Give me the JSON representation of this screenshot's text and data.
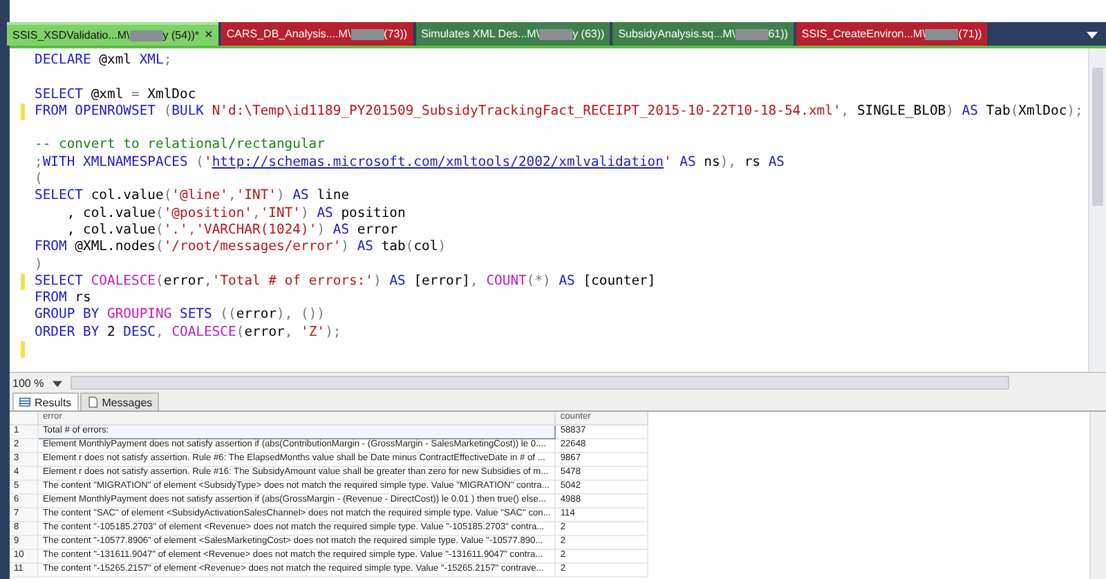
{
  "tabs": [
    {
      "label_start": "SSIS_XSDValidatio...M\\",
      "label_end": "y (54))*",
      "redacted": true,
      "color": "#7fd16a",
      "selected": true,
      "close": "×"
    },
    {
      "label_start": "CARS_DB_Analysis....M\\",
      "label_end": "(73))",
      "redacted": true,
      "color": "#b8202e",
      "selected": false
    },
    {
      "label_start": "Simulates XML Des...M\\",
      "label_end": "y (63))",
      "redacted": true,
      "color": "#3f7f4c",
      "selected": false
    },
    {
      "label_start": "SubsidyAnalysis.sq...M\\",
      "label_end": "61))",
      "redacted": true,
      "color": "#3f7f4c",
      "selected": false
    },
    {
      "label_start": "SSIS_CreateEnviron...M\\",
      "label_end": "(71))",
      "redacted": true,
      "color": "#b8202e",
      "selected": false
    }
  ],
  "editor": {
    "lines": [
      {
        "changed": false,
        "tokens": [
          {
            "kind": "kw",
            "text": "DECLARE"
          },
          {
            "kind": "plain",
            "text": " @xml "
          },
          {
            "kind": "kw",
            "text": "XML"
          },
          {
            "kind": "op",
            "text": ";"
          }
        ]
      },
      {
        "changed": false
      },
      {
        "changed": false,
        "tokens": [
          {
            "kind": "kw",
            "text": "SELECT"
          },
          {
            "kind": "plain",
            "text": " @xml "
          },
          {
            "kind": "op",
            "text": "="
          },
          {
            "kind": "plain",
            "text": " XmlDoc"
          }
        ]
      },
      {
        "changed": true,
        "tokens": [
          {
            "kind": "kw",
            "text": "FROM OPENROWSET"
          },
          {
            "kind": "op",
            "text": " ("
          },
          {
            "kind": "kw",
            "text": "BULK"
          },
          {
            "kind": "str",
            "text": " N'd:\\Temp\\id1189_PY201509_SubsidyTrackingFact_RECEIPT_2015-10-22T10-18-54.xml'"
          },
          {
            "kind": "op",
            "text": ","
          },
          {
            "kind": "plain",
            "text": " SINGLE_BLOB"
          },
          {
            "kind": "op",
            "text": ")"
          },
          {
            "kind": "kw",
            "text": " AS"
          },
          {
            "kind": "plain",
            "text": " Tab"
          },
          {
            "kind": "op",
            "text": "("
          },
          {
            "kind": "plain",
            "text": "XmlDoc"
          },
          {
            "kind": "op",
            "text": ");"
          }
        ]
      },
      {
        "changed": false
      },
      {
        "changed": false,
        "tokens": [
          {
            "kind": "comment",
            "text": "-- convert to relational/rectangular"
          }
        ]
      },
      {
        "changed": false,
        "tokens": [
          {
            "kind": "op",
            "text": ";"
          },
          {
            "kind": "kw",
            "text": "WITH XMLNAMESPACES"
          },
          {
            "kind": "op",
            "text": " ("
          },
          {
            "kind": "str",
            "text": "'"
          },
          {
            "kind": "link",
            "text": "http://schemas.microsoft.com/xmltools/2002/xmlvalidation"
          },
          {
            "kind": "str",
            "text": "'"
          },
          {
            "kind": "kw",
            "text": " AS"
          },
          {
            "kind": "plain",
            "text": " ns"
          },
          {
            "kind": "op",
            "text": "),"
          },
          {
            "kind": "plain",
            "text": " rs "
          },
          {
            "kind": "kw",
            "text": "AS"
          }
        ]
      },
      {
        "changed": false,
        "tokens": [
          {
            "kind": "op",
            "text": "("
          }
        ]
      },
      {
        "changed": false,
        "tokens": [
          {
            "kind": "kw",
            "text": "SELECT"
          },
          {
            "kind": "plain",
            "text": " col.value"
          },
          {
            "kind": "op",
            "text": "("
          },
          {
            "kind": "str",
            "text": "'@line'"
          },
          {
            "kind": "op",
            "text": ","
          },
          {
            "kind": "str",
            "text": "'INT'"
          },
          {
            "kind": "op",
            "text": ")"
          },
          {
            "kind": "kw",
            "text": " AS"
          },
          {
            "kind": "plain",
            "text": " line"
          }
        ]
      },
      {
        "changed": false,
        "tokens": [
          {
            "kind": "plain",
            "text": "    , col.value"
          },
          {
            "kind": "op",
            "text": "("
          },
          {
            "kind": "str",
            "text": "'@position'"
          },
          {
            "kind": "op",
            "text": ","
          },
          {
            "kind": "str",
            "text": "'INT'"
          },
          {
            "kind": "op",
            "text": ")"
          },
          {
            "kind": "kw",
            "text": " AS"
          },
          {
            "kind": "plain",
            "text": " position"
          }
        ]
      },
      {
        "changed": false,
        "tokens": [
          {
            "kind": "plain",
            "text": "    , col.value"
          },
          {
            "kind": "op",
            "text": "("
          },
          {
            "kind": "str",
            "text": "'.'"
          },
          {
            "kind": "op",
            "text": ","
          },
          {
            "kind": "str",
            "text": "'VARCHAR(1024)'"
          },
          {
            "kind": "op",
            "text": ")"
          },
          {
            "kind": "kw",
            "text": " AS"
          },
          {
            "kind": "plain",
            "text": " error"
          }
        ]
      },
      {
        "changed": false,
        "tokens": [
          {
            "kind": "kw",
            "text": "FROM"
          },
          {
            "kind": "plain",
            "text": " @XML.nodes"
          },
          {
            "kind": "op",
            "text": "("
          },
          {
            "kind": "str",
            "text": "'/root/messages/error'"
          },
          {
            "kind": "op",
            "text": ")"
          },
          {
            "kind": "kw",
            "text": " AS"
          },
          {
            "kind": "plain",
            "text": " tab"
          },
          {
            "kind": "op",
            "text": "("
          },
          {
            "kind": "plain",
            "text": "col"
          },
          {
            "kind": "op",
            "text": ")"
          }
        ]
      },
      {
        "changed": false,
        "tokens": [
          {
            "kind": "op",
            "text": ")"
          }
        ]
      },
      {
        "changed": true,
        "tokens": [
          {
            "kind": "kw",
            "text": "SELECT"
          },
          {
            "kind": "fn",
            "text": " COALESCE"
          },
          {
            "kind": "op",
            "text": "("
          },
          {
            "kind": "plain",
            "text": "error"
          },
          {
            "kind": "op",
            "text": ","
          },
          {
            "kind": "str",
            "text": "'Total # of errors:'"
          },
          {
            "kind": "op",
            "text": ")"
          },
          {
            "kind": "kw",
            "text": " AS"
          },
          {
            "kind": "plain",
            "text": " [error]"
          },
          {
            "kind": "op",
            "text": ","
          },
          {
            "kind": "fn",
            "text": " COUNT"
          },
          {
            "kind": "op",
            "text": "(*)"
          },
          {
            "kind": "kw",
            "text": " AS"
          },
          {
            "kind": "plain",
            "text": " [counter]"
          }
        ]
      },
      {
        "changed": false,
        "tokens": [
          {
            "kind": "kw",
            "text": "FROM"
          },
          {
            "kind": "plain",
            "text": " rs"
          }
        ]
      },
      {
        "changed": false,
        "tokens": [
          {
            "kind": "kw",
            "text": "GROUP BY"
          },
          {
            "kind": "fn",
            "text": " GROUPING"
          },
          {
            "kind": "kw",
            "text": " SETS"
          },
          {
            "kind": "op",
            "text": " (("
          },
          {
            "kind": "plain",
            "text": "error"
          },
          {
            "kind": "op",
            "text": "),"
          },
          {
            "kind": "op",
            "text": " ())"
          }
        ]
      },
      {
        "changed": false,
        "tokens": [
          {
            "kind": "kw",
            "text": "ORDER BY"
          },
          {
            "kind": "plain",
            "text": " 2 "
          },
          {
            "kind": "kw",
            "text": "DESC"
          },
          {
            "kind": "op",
            "text": ","
          },
          {
            "kind": "fn",
            "text": " COALESCE"
          },
          {
            "kind": "op",
            "text": "("
          },
          {
            "kind": "plain",
            "text": "error"
          },
          {
            "kind": "op",
            "text": ","
          },
          {
            "kind": "str",
            "text": " 'Z'"
          },
          {
            "kind": "op",
            "text": ");"
          }
        ]
      },
      {
        "changed": true
      }
    ]
  },
  "zoom": "100 %",
  "result_tabs": [
    {
      "label": "Results",
      "selected": true
    },
    {
      "label": "Messages",
      "selected": false
    }
  ],
  "grid": {
    "columns": [
      "error",
      "counter"
    ],
    "rows": [
      {
        "num": "1",
        "error": "Total # of errors:",
        "counter": "58837",
        "selected": true
      },
      {
        "num": "2",
        "error": "Element MonthlyPayment does not satisfy assertion if (abs(ContributionMargin - (GrossMargin - SalesMarketingCost)) le 0....",
        "counter": "22648",
        "selected": false
      },
      {
        "num": "3",
        "error": "Element r does not satisfy assertion. Rule #6: The ElapsedMonths value shall be Date minus ContractEffectiveDate in # of ...",
        "counter": "9867",
        "selected": false
      },
      {
        "num": "4",
        "error": "Element r does not satisfy assertion. Rule #16: The SubsidyAmount value shall be greater than zero for new Subsidies of m...",
        "counter": "5478",
        "selected": false
      },
      {
        "num": "5",
        "error": "The content \"MIGRATION\" of element <SubsidyType> does not match the required simple type. Value \"MIGRATION\" contra...",
        "counter": "5042",
        "selected": false
      },
      {
        "num": "6",
        "error": "Element MonthlyPayment does not satisfy assertion if (abs(GrossMargin - (Revenue - DirectCost)) le 0.01 ) then true() else...",
        "counter": "4988",
        "selected": false
      },
      {
        "num": "7",
        "error": "The content \"SAC\" of element <SubsidyActivationSalesChannel> does not match the required simple type. Value \"SAC\" con...",
        "counter": "114",
        "selected": false
      },
      {
        "num": "8",
        "error": "The content \"-105185.2703\" of element <Revenue> does not match the required simple type. Value \"-105185.2703\" contra...",
        "counter": "2",
        "selected": false
      },
      {
        "num": "9",
        "error": "The content \"-10577.8906\" of element <SalesMarketingCost> does not match the required simple type. Value \"-10577.890...",
        "counter": "2",
        "selected": false
      },
      {
        "num": "10",
        "error": "The content \"-131611.9047\" of element <Revenue> does not match the required simple type. Value \"-131611.9047\" contra...",
        "counter": "2",
        "selected": false
      },
      {
        "num": "11",
        "error": "The content \"-15265.2157\" of element <Revenue> does not match the required simple type. Value \"-15265.2157\" contrave...",
        "counter": "2",
        "selected": false
      }
    ]
  }
}
